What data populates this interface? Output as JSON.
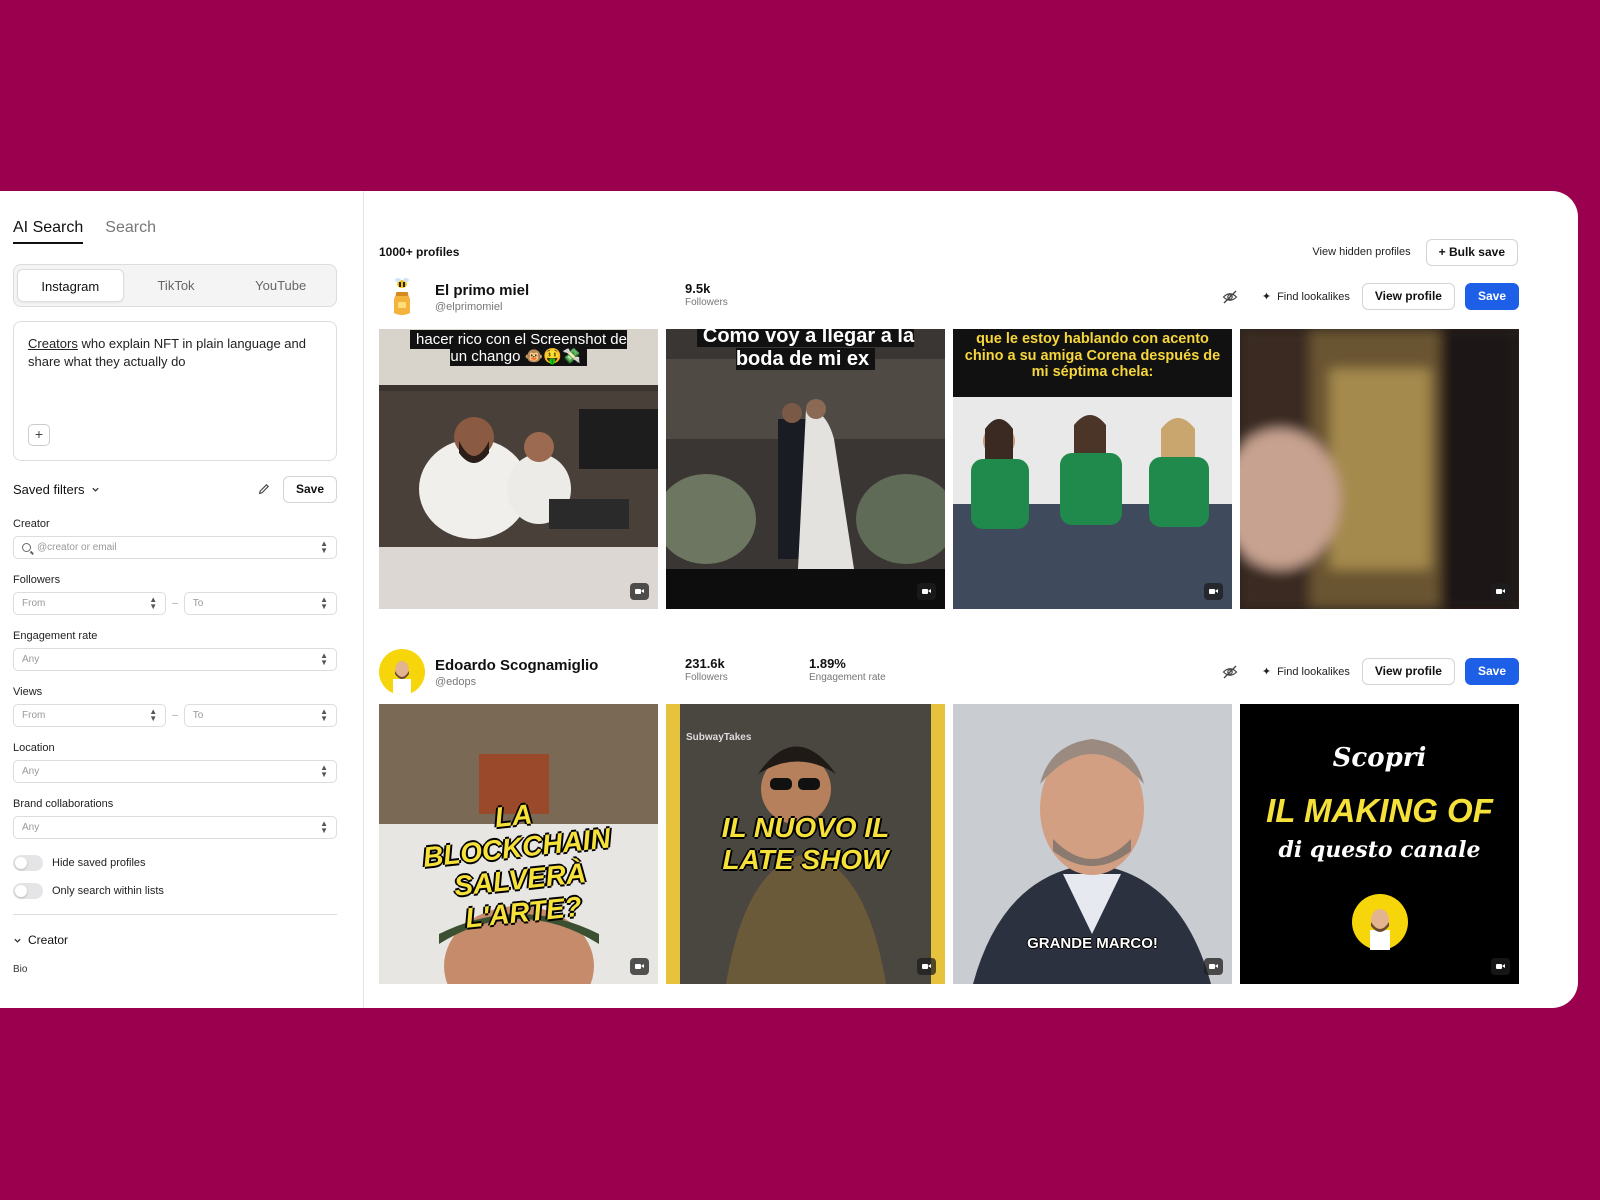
{
  "sidebar": {
    "mode_tabs": [
      {
        "label": "AI Search",
        "active": true
      },
      {
        "label": "Search",
        "active": false
      }
    ],
    "platforms": [
      {
        "label": "Instagram",
        "active": true
      },
      {
        "label": "TikTok",
        "active": false
      },
      {
        "label": "YouTube",
        "active": false
      }
    ],
    "prompt": {
      "underlined": "Creators",
      "rest": " who explain NFT in plain language and share what they actually do"
    },
    "saved_filters_label": "Saved filters",
    "save_label": "Save",
    "filters": {
      "creator": {
        "label": "Creator",
        "placeholder": "@creator or email"
      },
      "followers": {
        "label": "Followers",
        "from": "From",
        "to": "To"
      },
      "engagement": {
        "label": "Engagement rate",
        "value": "Any"
      },
      "views": {
        "label": "Views",
        "from": "From",
        "to": "To"
      },
      "location": {
        "label": "Location",
        "value": "Any"
      },
      "brand": {
        "label": "Brand collaborations",
        "value": "Any"
      }
    },
    "toggles": {
      "hide_saved": "Hide saved profiles",
      "within_lists": "Only search within lists"
    },
    "section_creator": "Creator",
    "bio_label": "Bio"
  },
  "main": {
    "count": "1000+ profiles",
    "view_hidden": "View hidden profiles",
    "bulk_save": "+ Bulk save",
    "actions": {
      "lookalikes": "Find lookalikes",
      "view_profile": "View profile",
      "save": "Save"
    },
    "profiles": [
      {
        "name": "El primo miel",
        "handle": "@elprimomiel",
        "followers": "9.5k",
        "followers_label": "Followers",
        "thumbs": [
          {
            "caption": "hacer rico con el Screenshot de un chango 🐵🤑💸"
          },
          {
            "caption": "Como voy a llegar a la boda de mi ex"
          },
          {
            "caption": "que le estoy hablando con acento chino a su amiga Corena después de mi séptima chela:"
          },
          {
            "caption": ""
          }
        ]
      },
      {
        "name": "Edoardo Scognamiglio",
        "handle": "@edops",
        "followers": "231.6k",
        "followers_label": "Followers",
        "engagement": "1.89%",
        "engagement_label": "Engagement rate",
        "thumbs": [
          {
            "caption": "LA BLOCKCHAIN SALVERÀ L'ARTE?"
          },
          {
            "caption": "IL NUOVO IL LATE SHOW",
            "watermark": "SubwayTakes"
          },
          {
            "caption": "GRANDE MARCO!"
          },
          {
            "caption_top": "Scopri",
            "caption_main": "IL MAKING OF",
            "caption_bottom": "di questo canale"
          }
        ]
      }
    ]
  }
}
